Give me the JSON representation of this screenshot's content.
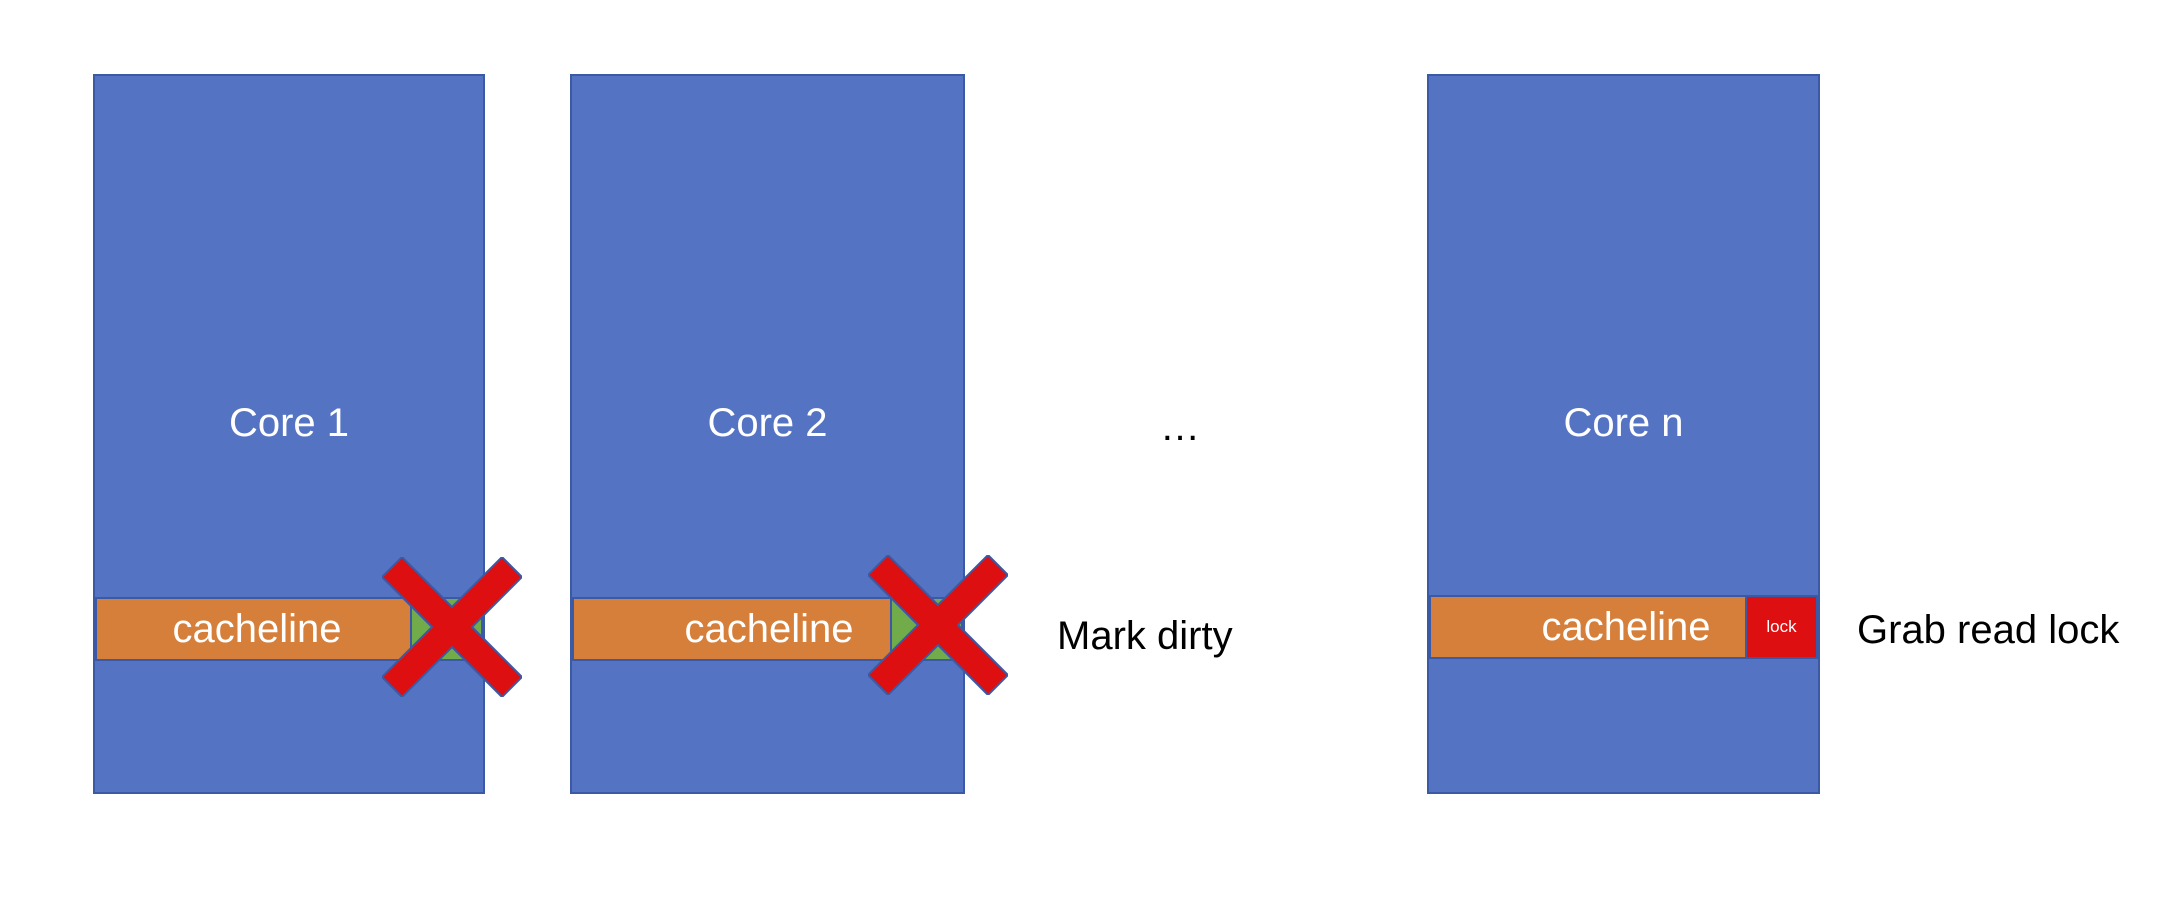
{
  "cores": [
    {
      "label": "Core 1",
      "cacheline_label": "cacheline",
      "marker": "x-mark"
    },
    {
      "label": "Core 2",
      "cacheline_label": "cacheline",
      "marker": "x-mark"
    },
    {
      "label": "Core n",
      "cacheline_label": "cacheline",
      "marker": "lock",
      "lock_label": "lock"
    }
  ],
  "ellipsis": "…",
  "annotations": {
    "mark_dirty": "Mark dirty",
    "grab_read_lock": "Grab read lock"
  },
  "colors": {
    "core_fill": "#5573c3",
    "cacheline_fill": "#d57f3a",
    "dirty_slot_fill": "#72ab4a",
    "x_mark": "#dd0f10",
    "lock_fill": "#dd0f10",
    "outline": "#3b5aa6"
  },
  "icons": {
    "cross": "x-mark-icon"
  }
}
